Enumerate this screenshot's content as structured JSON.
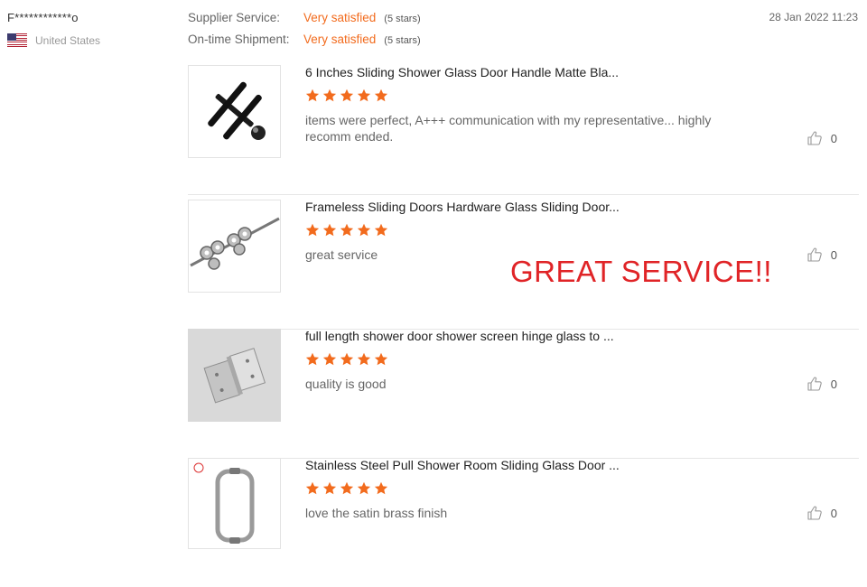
{
  "reviewer": {
    "name": "F************o",
    "country": "United States",
    "flag_icon": "us-flag-icon"
  },
  "ratings": [
    {
      "label": "Supplier Service:",
      "value": "Very satisfied",
      "stars": "(5 stars)"
    },
    {
      "label": "On-time Shipment:",
      "value": "Very satisfied",
      "stars": "(5 stars)"
    }
  ],
  "date": "28 Jan 2022 11:23",
  "items": [
    {
      "title": "6 Inches Sliding Shower Glass Door Handle Matte Bla...",
      "rating": 5,
      "text": "items were perfect, A+++ communication with my representative... highly recomm ended.",
      "likes": "0"
    },
    {
      "title": "Frameless Sliding Doors Hardware Glass Sliding Door...",
      "rating": 5,
      "text": "great service",
      "likes": "0"
    },
    {
      "title": "full length shower door shower screen hinge glass to ...",
      "rating": 5,
      "text": "quality is good",
      "likes": "0"
    },
    {
      "title": "Stainless Steel Pull Shower Room Sliding Glass Door ...",
      "rating": 5,
      "text": "love the satin brass finish",
      "likes": "0"
    }
  ],
  "overlay_text": "GREAT SERVICE!!",
  "colors": {
    "accent": "#f26b1d",
    "star": "#f26b1d",
    "overlay": "#e02427"
  }
}
